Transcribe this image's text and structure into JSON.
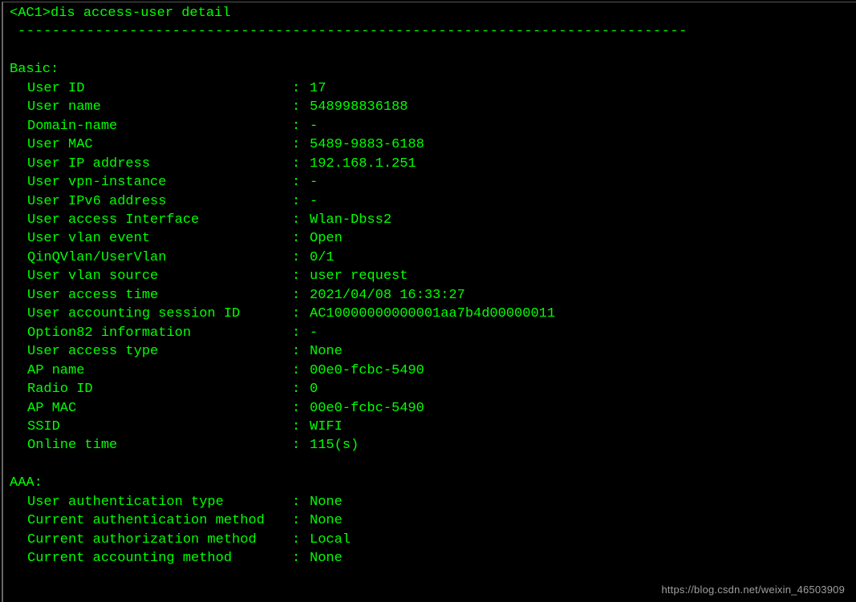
{
  "prompt": "<AC1>dis access-user detail",
  "separator": "------------------------------------------------------------------------------",
  "sections": [
    {
      "title": "Basic:",
      "fields": [
        {
          "label": "User ID",
          "value": "17"
        },
        {
          "label": "User name",
          "value": "548998836188"
        },
        {
          "label": "Domain-name",
          "value": "-"
        },
        {
          "label": "User MAC",
          "value": "5489-9883-6188"
        },
        {
          "label": "User IP address",
          "value": "192.168.1.251"
        },
        {
          "label": "User vpn-instance",
          "value": "-"
        },
        {
          "label": "User IPv6 address",
          "value": "-"
        },
        {
          "label": "User access Interface",
          "value": "Wlan-Dbss2"
        },
        {
          "label": "User vlan event",
          "value": "Open"
        },
        {
          "label": "QinQVlan/UserVlan",
          "value": "0/1"
        },
        {
          "label": "User vlan source",
          "value": "user request"
        },
        {
          "label": "User access time",
          "value": "2021/04/08 16:33:27"
        },
        {
          "label": "User accounting session ID",
          "value": "AC10000000000001aa7b4d00000011"
        },
        {
          "label": "Option82 information",
          "value": "-"
        },
        {
          "label": "User access type",
          "value": "None"
        },
        {
          "label": "AP name",
          "value": "00e0-fcbc-5490"
        },
        {
          "label": "Radio ID",
          "value": "0"
        },
        {
          "label": "AP MAC",
          "value": "00e0-fcbc-5490"
        },
        {
          "label": "SSID",
          "value": "WIFI"
        },
        {
          "label": "Online time",
          "value": "115(s)"
        }
      ]
    },
    {
      "title": "AAA:",
      "fields": [
        {
          "label": "User authentication type",
          "value": "None"
        },
        {
          "label": "Current authentication method",
          "value": "None"
        },
        {
          "label": "Current authorization method",
          "value": "Local"
        },
        {
          "label": "Current accounting method",
          "value": "None"
        }
      ]
    }
  ],
  "watermark": "https://blog.csdn.net/weixin_46503909"
}
